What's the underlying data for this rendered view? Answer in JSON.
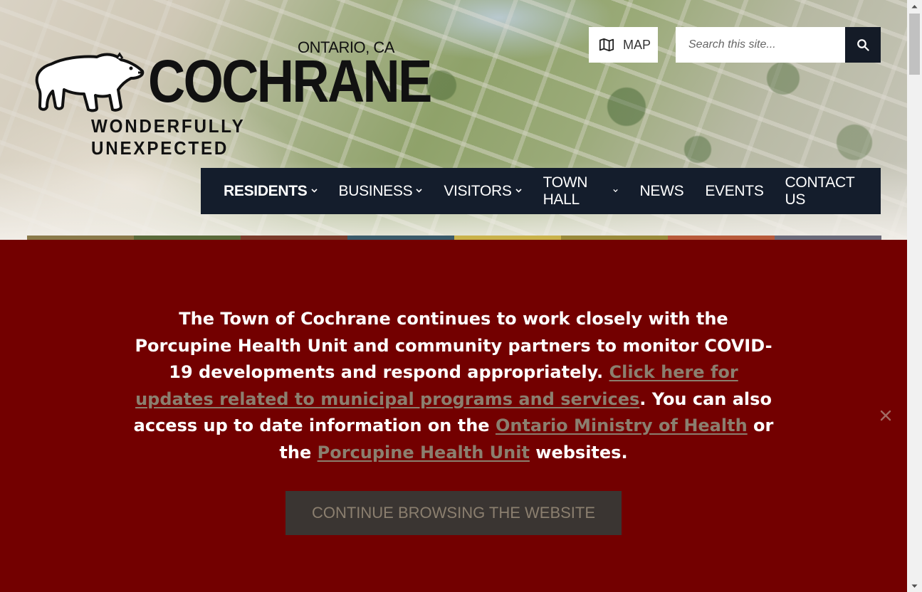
{
  "header": {
    "logo": {
      "region": "ONTARIO, CA",
      "name": "COCHRANE",
      "tagline": "WONDERFULLY UNEXPECTED"
    },
    "map_button": {
      "label": "MAP",
      "icon": "map-icon"
    },
    "search": {
      "placeholder": "Search this site...",
      "icon": "search-icon"
    }
  },
  "nav": {
    "items": [
      {
        "label": "RESIDENTS",
        "dropdown": true,
        "active": true
      },
      {
        "label": "BUSINESS",
        "dropdown": true
      },
      {
        "label": "VISITORS",
        "dropdown": true
      },
      {
        "label": "TOWN HALL",
        "dropdown": true
      },
      {
        "label": "NEWS",
        "dropdown": false
      },
      {
        "label": "EVENTS",
        "dropdown": false
      },
      {
        "label": "CONTACT US",
        "dropdown": false
      }
    ]
  },
  "banner": {
    "text_1": "The Town of Cochrane continues to work closely with the Porcupine Health Unit and community partners to monitor COVID-19 developments and respond appropriately. ",
    "link_1": "Click here for updates related to municipal programs and services",
    "text_2": ". You can also access up to date information on the ",
    "link_2": "Ontario Ministry of Health",
    "text_3": " or the ",
    "link_3": "Porcupine Health Unit",
    "text_4": " websites.",
    "continue_label": "CONTINUE BROWSING THE WEBSITE",
    "close_icon": "close-icon"
  },
  "colors": {
    "nav_bg": "#141d2c",
    "banner_bg": "#730000",
    "link": "#8b7f6f",
    "button_bg": "#3a3532"
  }
}
